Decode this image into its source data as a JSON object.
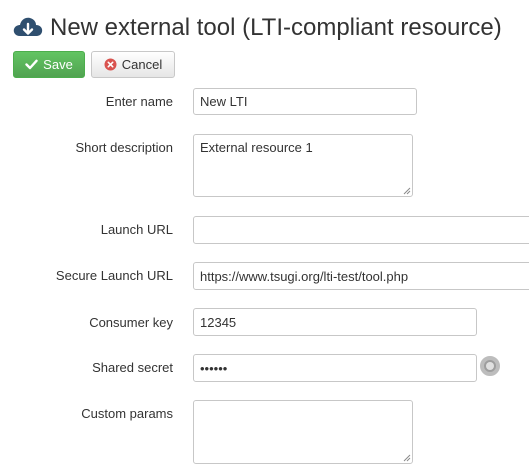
{
  "page": {
    "title": "New external tool (LTI-compliant resource)"
  },
  "toolbar": {
    "save_label": "Save",
    "cancel_label": "Cancel"
  },
  "form": {
    "name": {
      "label": "Enter name",
      "value": "New LTI"
    },
    "short_description": {
      "label": "Short description",
      "value": "External resource 1"
    },
    "launch_url": {
      "label": "Launch URL",
      "value": ""
    },
    "secure_launch_url": {
      "label": "Secure Launch URL",
      "value": "https://www.tsugi.org/lti-test/tool.php"
    },
    "consumer_key": {
      "label": "Consumer key",
      "value": "12345"
    },
    "shared_secret": {
      "label": "Shared secret",
      "value": "secret"
    },
    "custom_params": {
      "label": "Custom params",
      "value": ""
    }
  },
  "icons": {
    "header": "cloud-download-icon",
    "save": "check-icon",
    "cancel": "x-circle-icon",
    "toggle": "show-secret-icon"
  },
  "colors": {
    "save_button": "#5cb85c",
    "cancel_icon": "#d9534f",
    "header_icon": "#2f4f6f"
  }
}
